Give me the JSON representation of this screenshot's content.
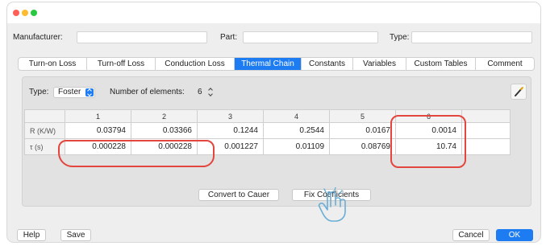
{
  "colors": {
    "accent": "#1e7cf2",
    "annotation": "#e2463e"
  },
  "header": {
    "manufacturer_label": "Manufacturer:",
    "manufacturer_value": "",
    "part_label": "Part:",
    "part_value": "",
    "type_label": "Type:",
    "type_value": ""
  },
  "tabs": [
    {
      "label": "Turn-on Loss"
    },
    {
      "label": "Turn-off Loss"
    },
    {
      "label": "Conduction Loss"
    },
    {
      "label": "Thermal Chain",
      "active": true
    },
    {
      "label": "Constants"
    },
    {
      "label": "Variables"
    },
    {
      "label": "Custom Tables"
    },
    {
      "label": "Comment"
    }
  ],
  "thermal": {
    "type_label": "Type:",
    "type_value": "Foster",
    "elements_label": "Number of elements:",
    "elements_value": "6",
    "columns": [
      "1",
      "2",
      "3",
      "4",
      "5",
      "6"
    ],
    "rows": [
      {
        "label": "R (K/W)",
        "values": [
          "0.03794",
          "0.03366",
          "0.1244",
          "0.2544",
          "0.0167",
          "0.0014"
        ]
      },
      {
        "label": "τ (s)",
        "values": [
          "0.000228",
          "0.000228",
          "0.001227",
          "0.01109",
          "0.08769",
          "10.74"
        ]
      }
    ],
    "convert_button": "Convert to Cauer",
    "fix_button": "Fix Coefficients"
  },
  "footer": {
    "help_button": "Help",
    "save_button": "Save",
    "cancel_button": "Cancel",
    "ok_button": "OK"
  }
}
